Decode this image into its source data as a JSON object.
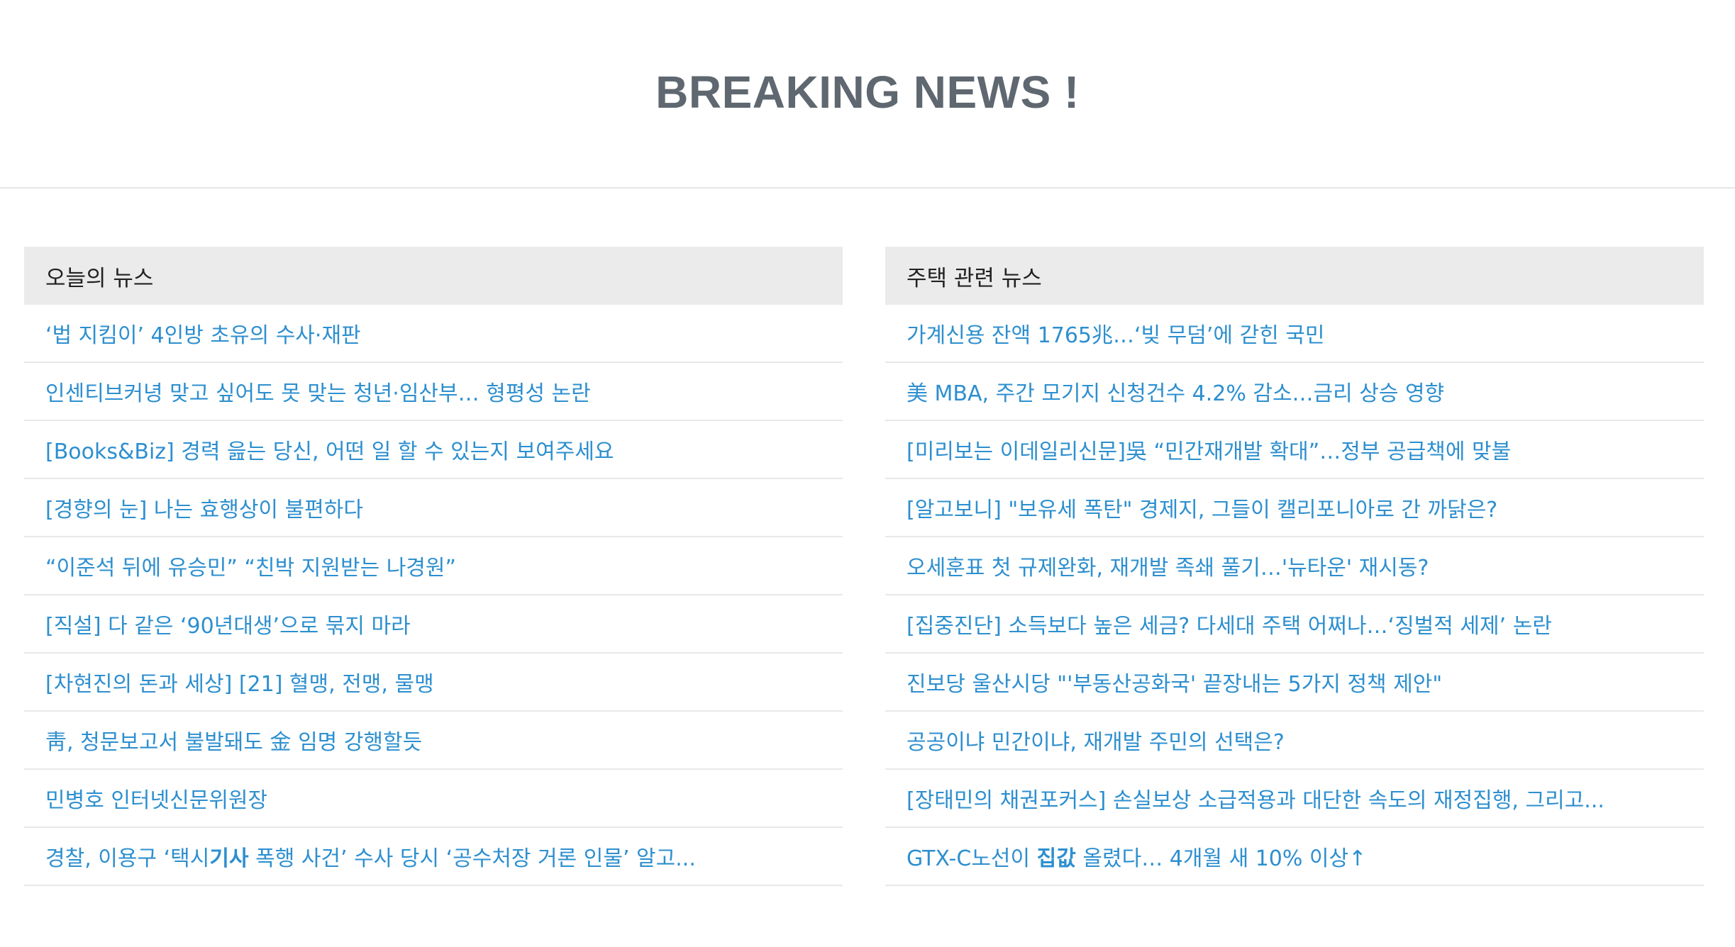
{
  "page": {
    "title": "BREAKING NEWS !"
  },
  "colors": {
    "title": "#5f6770",
    "link": "#2d8fcf",
    "panel_header_bg": "#ebebeb",
    "divider": "#e8e8e8"
  },
  "today_news": {
    "header": "오늘의 뉴스",
    "items": [
      {
        "text": "‘법 지킴이’ 4인방 초유의 수사·재판"
      },
      {
        "text": "인센티브커녕 맞고 싶어도 못 맞는 청년·임산부… 형평성 논란"
      },
      {
        "text": "[Books&Biz] 경력 읊는 당신, 어떤 일 할 수 있는지 보여주세요"
      },
      {
        "text": "[경향의 눈] 나는 효행상이 불편하다"
      },
      {
        "text": "“이준석 뒤에 유승민” “친박 지원받는 나경원”"
      },
      {
        "text": "[직설] 다 같은 ‘90년대생’으로 묶지 마라"
      },
      {
        "text": "[차현진의 돈과 세상] [21] 혈맹, 전맹, 물맹"
      },
      {
        "text": "靑, 청문보고서 불발돼도 金 임명 강행할듯"
      },
      {
        "text": "민병호 인터넷신문위원장"
      },
      {
        "pre": "경찰, 이용구 ‘택시",
        "bold": "기사",
        "post": " 폭행 사건’ 수사 당시 ‘공수처장 거론 인물’ 알고..."
      }
    ]
  },
  "housing_news": {
    "header": "주택 관련 뉴스",
    "items": [
      {
        "text": "가계신용 잔액 1765兆…‘빚 무덤’에 갇힌 국민"
      },
      {
        "text": "美 MBA, 주간 모기지 신청건수 4.2% 감소…금리 상승 영향"
      },
      {
        "text": "[미리보는 이데일리신문]吳 “민간재개발 확대”…정부 공급책에 맞불"
      },
      {
        "text": "[알고보니] \"보유세 폭탄\" 경제지, 그들이 캘리포니아로 간 까닭은?"
      },
      {
        "text": "오세훈표 첫 규제완화, 재개발 족쇄 풀기…'뉴타운' 재시동?"
      },
      {
        "text": "[집중진단] 소득보다 높은 세금? 다세대 주택 어쩌나…‘징벌적 세제’ 논란"
      },
      {
        "text": "진보당 울산시당 \"'부동산공화국' 끝장내는 5가지 정책 제안\""
      },
      {
        "text": "공공이냐 민간이냐, 재개발 주민의 선택은?"
      },
      {
        "text": "[장태민의 채권포커스] 손실보상 소급적용과 대단한 속도의 재정집행, 그리고..."
      },
      {
        "pre": "GTX-C노선이 ",
        "bold": "집값",
        "post": " 올렸다… 4개월 새 10% 이상↑"
      }
    ]
  }
}
